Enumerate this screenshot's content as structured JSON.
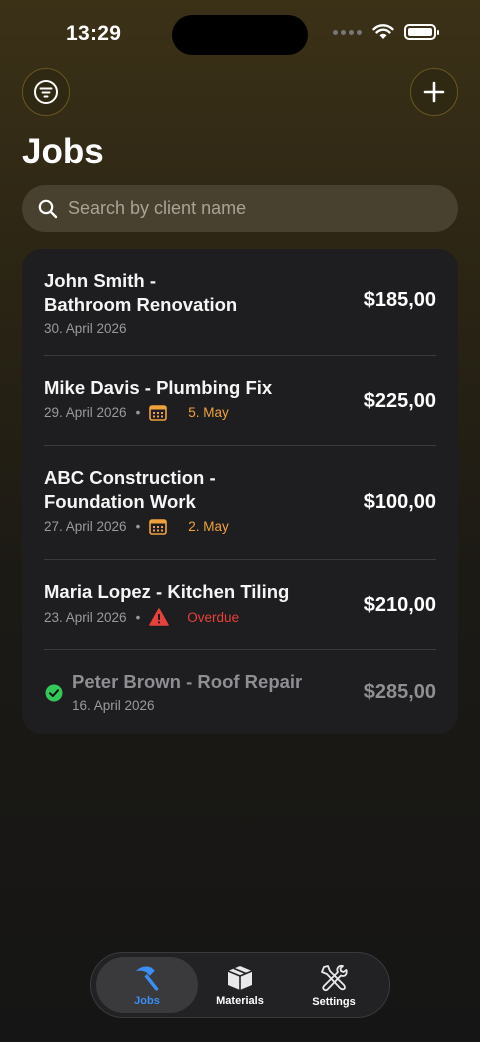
{
  "status_bar": {
    "time": "13:29"
  },
  "header": {
    "title": "Jobs"
  },
  "search": {
    "placeholder": "Search by client name"
  },
  "jobs": [
    {
      "title": "John Smith -\nBathroom Renovation",
      "date": "30. April 2026",
      "due": "",
      "price": "$185,00",
      "completed": false
    },
    {
      "title": "Mike Davis - Plumbing Fix",
      "date": "29. April 2026",
      "due": "5. May",
      "price": "$225,00",
      "completed": false
    },
    {
      "title": "ABC Construction -\nFoundation Work",
      "date": "27. April 2026",
      "due": "2. May",
      "price": "$100,00",
      "completed": false
    },
    {
      "title": "Maria Lopez - Kitchen Tiling",
      "date": "23. April 2026",
      "due": "Overdue",
      "price": "$210,00",
      "completed": false
    },
    {
      "title": "Peter Brown - Roof Repair",
      "date": "16. April 2026",
      "due": "",
      "price": "$285,00",
      "completed": true
    }
  ],
  "tabs": [
    {
      "label": "Jobs",
      "icon": "hammer-icon",
      "active": true
    },
    {
      "label": "Materials",
      "icon": "box-icon",
      "active": false
    },
    {
      "label": "Settings",
      "icon": "tools-icon",
      "active": false
    }
  ],
  "colors": {
    "accent": "#3a8ef6",
    "due_warning": "#f0a23a",
    "overdue": "#e8403a",
    "completed": "#34c759"
  }
}
